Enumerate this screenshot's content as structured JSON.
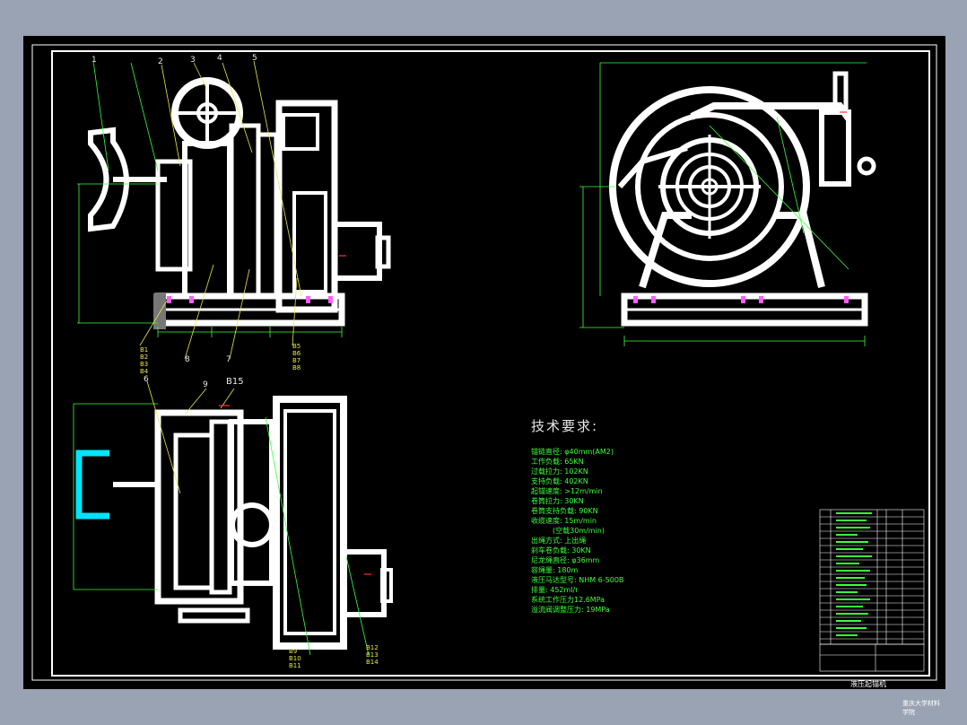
{
  "drawing": {
    "callouts_top": [
      "1",
      "2",
      "3",
      "4",
      "5"
    ],
    "callout_6": "6",
    "callout_7": "7",
    "callout_8": "8",
    "callout_9": "9",
    "callout_b15": "B15",
    "group_left": [
      "B1",
      "B2",
      "B3",
      "B4"
    ],
    "group_right": [
      "B5",
      "B6",
      "B7",
      "B8"
    ],
    "group_bottom_mid": [
      "B9",
      "B10",
      "B11"
    ],
    "group_bottom_right": [
      "B12",
      "B13",
      "B14"
    ]
  },
  "tech": {
    "title": "技术要求:",
    "items": [
      "锚链直径: φ40mm(AM2)",
      "工作负载: 65KN",
      "过载拉力: 102KN",
      "支持负载: 402KN",
      "起锚速度: >12m/min",
      "卷筒拉力: 30KN",
      "卷筒支持负载: 90KN",
      "收缆速度: 15m/min",
      "　　　(空载30m/min)",
      "出绳方式: 上出绳",
      "刹车卷负载: 30KN",
      "尼龙绳直径: φ36mm",
      "容绳量: 180m",
      "液压马达型号: NHM 6-500B",
      "排量: 452ml/r",
      "系统工作压力12.6MPa",
      "溢流阀调整压力: 19MPa"
    ]
  },
  "title_block": {
    "name": "液压起锚机",
    "school": "重庆大学材料学院"
  },
  "colors": {
    "sheet": "#000000",
    "background": "#9aa3b3",
    "line_white": "#ffffff",
    "dim_green": "#3cff3c",
    "callout_yellow": "#e8e84a",
    "accent_cyan": "#00e5ff",
    "accent_red": "#ff3030",
    "accent_magenta": "#ff5cff"
  }
}
